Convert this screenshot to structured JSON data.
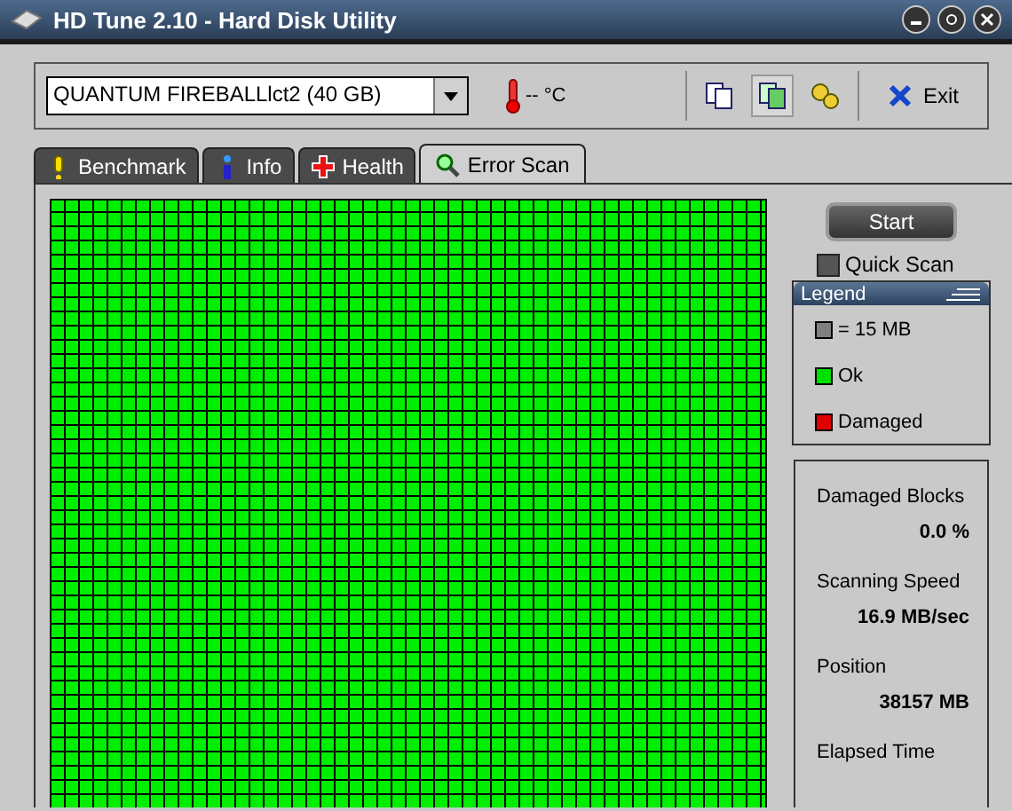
{
  "window": {
    "title": "HD Tune 2.10 - Hard Disk Utility"
  },
  "toolbar": {
    "drive": "QUANTUM FIREBALLlct2 (40 GB)",
    "temperature": "-- °C",
    "exit": "Exit"
  },
  "tabs": [
    {
      "label": "Benchmark",
      "selected": false
    },
    {
      "label": "Info",
      "selected": false
    },
    {
      "label": "Health",
      "selected": false
    },
    {
      "label": "Error Scan",
      "selected": true
    }
  ],
  "scan": {
    "start": "Start",
    "quick_scan": {
      "label": "Quick Scan",
      "checked": false
    }
  },
  "legend": {
    "title": "Legend",
    "items": [
      {
        "label": "= 15 MB",
        "color": "#808080"
      },
      {
        "label": "Ok",
        "color": "#00e000"
      },
      {
        "label": "Damaged",
        "color": "#e00000"
      }
    ]
  },
  "stats": [
    {
      "label": "Damaged Blocks",
      "value": "0.0 %"
    },
    {
      "label": "Scanning Speed",
      "value": "16.9 MB/sec"
    },
    {
      "label": "Position",
      "value": "38157 MB"
    },
    {
      "label": "Elapsed Time"
    }
  ]
}
